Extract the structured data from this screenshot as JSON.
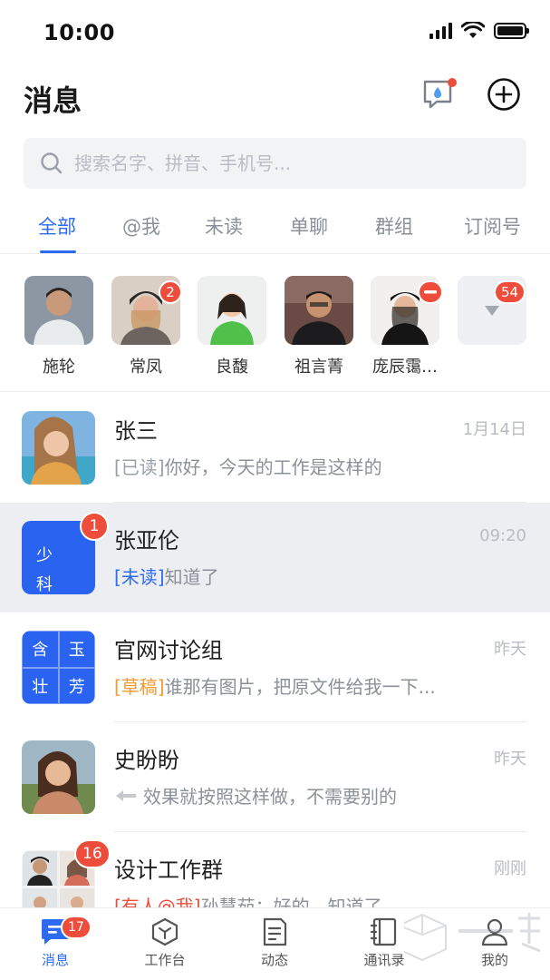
{
  "status": {
    "time": "10:00"
  },
  "header": {
    "title": "消息"
  },
  "search": {
    "placeholder": "搜索名字、拼音、手机号..."
  },
  "tabs": [
    "全部",
    "@我",
    "未读",
    "单聊",
    "群组",
    "订阅号"
  ],
  "pinned": [
    {
      "name": "施轮"
    },
    {
      "name": "常凤",
      "badge": "2"
    },
    {
      "name": "良馥"
    },
    {
      "name": "祖言菁"
    },
    {
      "name": "庞辰霭…"
    },
    {
      "badge": "54"
    }
  ],
  "chats": [
    {
      "title": "张三",
      "time": "1月14日",
      "tag": "[已读]",
      "text": "你好，今天的工作是这样的"
    },
    {
      "title": "张亚伦",
      "time": "09:20",
      "tag": "[未读]",
      "text": "知道了",
      "badge": "1",
      "avatar_text": [
        "少",
        "科"
      ]
    },
    {
      "title": "官网讨论组",
      "time": "昨天",
      "tag": "[草稿]",
      "text": "谁那有图片，把原文件给我一下...",
      "avatar_text": [
        "含",
        "玉",
        "壮",
        "芳"
      ]
    },
    {
      "title": "史盼盼",
      "time": "昨天",
      "tag": "",
      "text": "效果就按照这样做，不需要别的"
    },
    {
      "title": "设计工作群",
      "time": "刚刚",
      "tag": "[有人@我]",
      "text": "孙慧茹：好的，知道了",
      "badge": "16"
    }
  ],
  "bottom_nav": [
    {
      "label": "消息",
      "badge": "17"
    },
    {
      "label": "工作台"
    },
    {
      "label": "动态"
    },
    {
      "label": "通讯录"
    },
    {
      "label": "我的"
    }
  ],
  "colors": {
    "accent": "#2c6bf2",
    "badge": "#ee4d3b",
    "draft": "#f29a33",
    "highlight": "#eceef2"
  }
}
